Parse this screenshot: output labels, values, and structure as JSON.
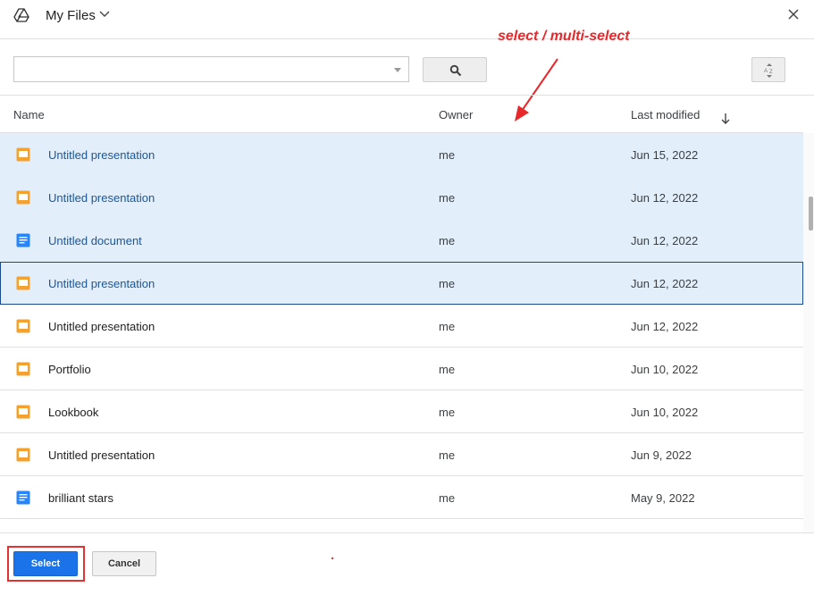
{
  "header": {
    "title": "My Files",
    "icons": {
      "logo": "drive-logo-icon",
      "chevron": "chevron-down-icon",
      "close": "close-icon"
    }
  },
  "annotation": {
    "text": "select / multi-select",
    "color": "#e8282a"
  },
  "toolbar": {
    "search_value": "",
    "search_placeholder": "",
    "search_button_icon": "search-icon",
    "sort_button_icon": "sort-az-icon"
  },
  "columns": {
    "name": "Name",
    "owner": "Owner",
    "modified": "Last modified",
    "sort_direction": "descending"
  },
  "files": [
    {
      "type": "presentation",
      "name": "Untitled presentation",
      "owner": "me",
      "modified": "Jun 15, 2022",
      "state": "selected"
    },
    {
      "type": "presentation",
      "name": "Untitled presentation",
      "owner": "me",
      "modified": "Jun 12, 2022",
      "state": "selected"
    },
    {
      "type": "document",
      "name": "Untitled document",
      "owner": "me",
      "modified": "Jun 12, 2022",
      "state": "selected"
    },
    {
      "type": "presentation",
      "name": "Untitled presentation",
      "owner": "me",
      "modified": "Jun 12, 2022",
      "state": "focused"
    },
    {
      "type": "presentation",
      "name": "Untitled presentation",
      "owner": "me",
      "modified": "Jun 12, 2022",
      "state": "normal"
    },
    {
      "type": "presentation",
      "name": "Portfolio",
      "owner": "me",
      "modified": "Jun 10, 2022",
      "state": "normal"
    },
    {
      "type": "presentation",
      "name": "Lookbook",
      "owner": "me",
      "modified": "Jun 10, 2022",
      "state": "normal"
    },
    {
      "type": "presentation",
      "name": "Untitled presentation",
      "owner": "me",
      "modified": "Jun 9, 2022",
      "state": "normal"
    },
    {
      "type": "document",
      "name": "brilliant stars",
      "owner": "me",
      "modified": "May 9, 2022",
      "state": "normal"
    }
  ],
  "footer": {
    "select_label": "Select",
    "cancel_label": "Cancel"
  },
  "colors": {
    "presentation": "#f4a22d",
    "document": "#2684fc",
    "primary": "#1a73e8",
    "highlight": "#e33232"
  }
}
